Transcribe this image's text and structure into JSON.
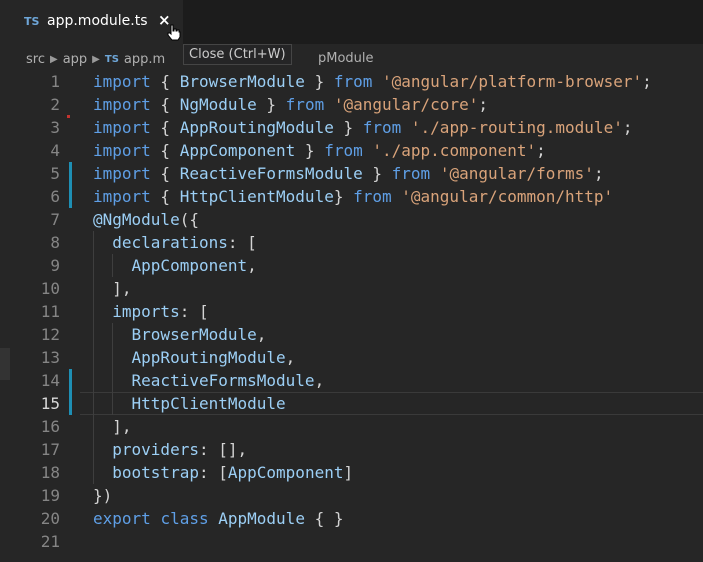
{
  "tab": {
    "lang": "TS",
    "title": "app.module.ts",
    "close_glyph": "×"
  },
  "tooltip": "Close (Ctrl+W)",
  "breadcrumb": {
    "items": [
      "src",
      "app"
    ],
    "file_lang": "TS",
    "file_visible": "app.m",
    "tail_visible": "pModule"
  },
  "editor": {
    "current_line": 15,
    "lines": [
      {
        "n": "1",
        "tokens": [
          [
            "kw",
            "import"
          ],
          [
            "pun",
            " { "
          ],
          [
            "id",
            "BrowserModule"
          ],
          [
            "pun",
            " } "
          ],
          [
            "kw",
            "from"
          ],
          [
            "pun",
            " "
          ],
          [
            "str",
            "'@angular/platform-browser'"
          ],
          [
            "pun",
            ";"
          ]
        ]
      },
      {
        "n": "2",
        "tokens": [
          [
            "kw",
            "import"
          ],
          [
            "pun",
            " { "
          ],
          [
            "id",
            "NgModule"
          ],
          [
            "pun",
            " } "
          ],
          [
            "kw",
            "from"
          ],
          [
            "pun",
            " "
          ],
          [
            "str",
            "'@angular/core'"
          ],
          [
            "pun",
            ";"
          ]
        ]
      },
      {
        "n": "3",
        "tokens": [
          [
            "kw",
            "import"
          ],
          [
            "pun",
            " { "
          ],
          [
            "id",
            "AppRoutingModule"
          ],
          [
            "pun",
            " } "
          ],
          [
            "kw",
            "from"
          ],
          [
            "pun",
            " "
          ],
          [
            "str",
            "'./app-routing.module'"
          ],
          [
            "pun",
            ";"
          ]
        ]
      },
      {
        "n": "4",
        "tokens": [
          [
            "kw",
            "import"
          ],
          [
            "pun",
            " { "
          ],
          [
            "id",
            "AppComponent"
          ],
          [
            "pun",
            " } "
          ],
          [
            "kw",
            "from"
          ],
          [
            "pun",
            " "
          ],
          [
            "str",
            "'./app.component'"
          ],
          [
            "pun",
            ";"
          ]
        ]
      },
      {
        "n": "5",
        "tokens": [
          [
            "kw",
            "import"
          ],
          [
            "pun",
            " { "
          ],
          [
            "id",
            "ReactiveFormsModule"
          ],
          [
            "pun",
            " } "
          ],
          [
            "kw",
            "from"
          ],
          [
            "pun",
            " "
          ],
          [
            "str",
            "'@angular/forms'"
          ],
          [
            "pun",
            ";"
          ]
        ]
      },
      {
        "n": "6",
        "tokens": [
          [
            "kw",
            "import"
          ],
          [
            "pun",
            " { "
          ],
          [
            "id",
            "HttpClientModule"
          ],
          [
            "pun",
            "} "
          ],
          [
            "kw",
            "from"
          ],
          [
            "pun",
            " "
          ],
          [
            "str",
            "'@angular/common/http'"
          ]
        ]
      },
      {
        "n": "7",
        "tokens": [
          [
            "id",
            "@NgModule"
          ],
          [
            "pun",
            "({"
          ]
        ]
      },
      {
        "n": "8",
        "tokens": [
          [
            "pun",
            "  "
          ],
          [
            "id",
            "declarations"
          ],
          [
            "pun",
            ": ["
          ]
        ]
      },
      {
        "n": "9",
        "tokens": [
          [
            "pun",
            "    "
          ],
          [
            "id",
            "AppComponent"
          ],
          [
            "pun",
            ","
          ]
        ]
      },
      {
        "n": "10",
        "tokens": [
          [
            "pun",
            "  ],"
          ]
        ]
      },
      {
        "n": "11",
        "tokens": [
          [
            "pun",
            "  "
          ],
          [
            "id",
            "imports"
          ],
          [
            "pun",
            ": ["
          ]
        ]
      },
      {
        "n": "12",
        "tokens": [
          [
            "pun",
            "    "
          ],
          [
            "id",
            "BrowserModule"
          ],
          [
            "pun",
            ","
          ]
        ]
      },
      {
        "n": "13",
        "tokens": [
          [
            "pun",
            "    "
          ],
          [
            "id",
            "AppRoutingModule"
          ],
          [
            "pun",
            ","
          ]
        ]
      },
      {
        "n": "14",
        "tokens": [
          [
            "pun",
            "    "
          ],
          [
            "id",
            "ReactiveFormsModule"
          ],
          [
            "pun",
            ","
          ]
        ]
      },
      {
        "n": "15",
        "tokens": [
          [
            "pun",
            "    "
          ],
          [
            "id",
            "HttpClientModule"
          ]
        ]
      },
      {
        "n": "16",
        "tokens": [
          [
            "pun",
            "  ],"
          ]
        ]
      },
      {
        "n": "17",
        "tokens": [
          [
            "pun",
            "  "
          ],
          [
            "id",
            "providers"
          ],
          [
            "pun",
            ": [],"
          ]
        ]
      },
      {
        "n": "18",
        "tokens": [
          [
            "pun",
            "  "
          ],
          [
            "id",
            "bootstrap"
          ],
          [
            "pun",
            ": ["
          ],
          [
            "id",
            "AppComponent"
          ],
          [
            "pun",
            "]"
          ]
        ]
      },
      {
        "n": "19",
        "tokens": [
          [
            "pun",
            "})"
          ]
        ]
      },
      {
        "n": "20",
        "tokens": [
          [
            "kw",
            "export"
          ],
          [
            "pun",
            " "
          ],
          [
            "kw",
            "class"
          ],
          [
            "pun",
            " "
          ],
          [
            "id",
            "AppModule"
          ],
          [
            "pun",
            " { }"
          ]
        ]
      },
      {
        "n": "21",
        "tokens": []
      }
    ]
  },
  "colors": {
    "keyword": "#5f9fe6",
    "identifier": "#9ccff5",
    "string": "#d9a37a",
    "punctuation": "#d4d4d4",
    "modified_gutter": "#1e8fb4"
  }
}
